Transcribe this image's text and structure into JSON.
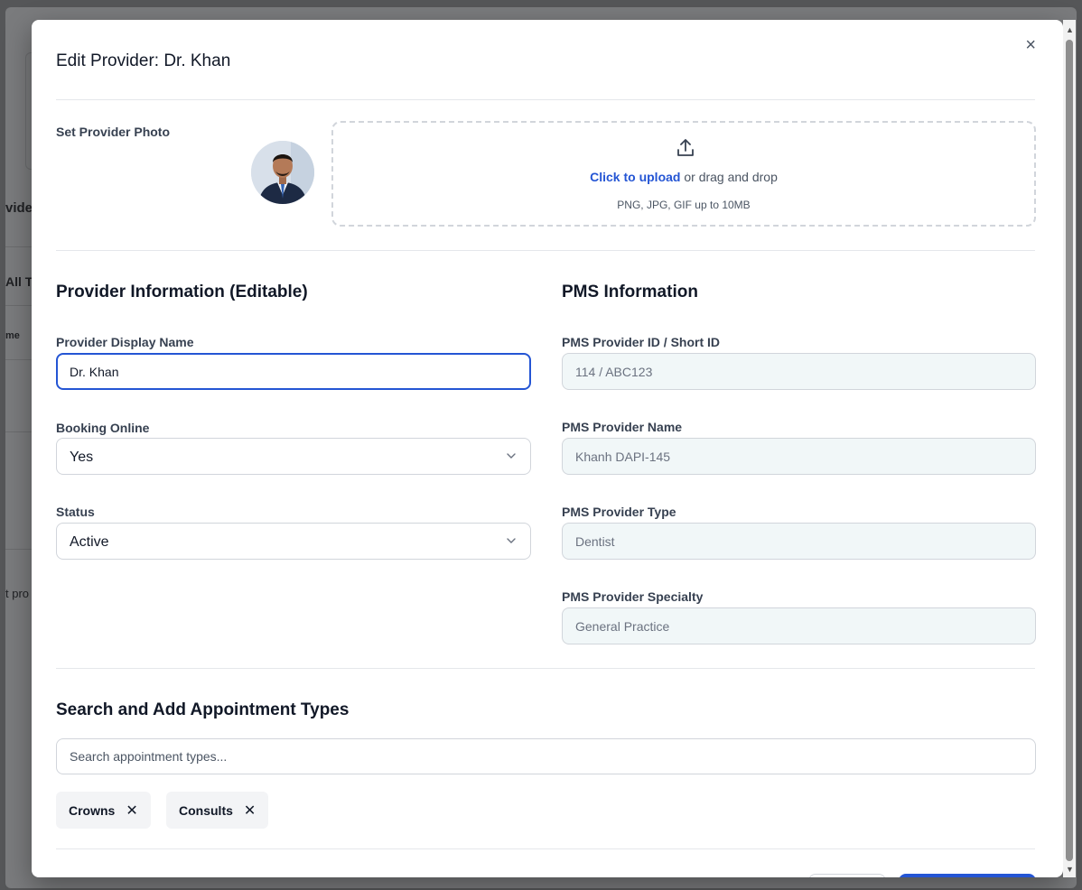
{
  "background": {
    "fragments": [
      "vide",
      "All Ty",
      "me",
      "t pro"
    ]
  },
  "modal": {
    "title": "Edit Provider: Dr. Khan",
    "close_icon": "×",
    "photo": {
      "label": "Set Provider Photo",
      "upload_link": "Click to upload",
      "upload_rest": " or drag and drop",
      "upload_hint": "PNG, JPG, GIF up to 10MB",
      "icon": "upload-icon"
    },
    "provider_info": {
      "title": "Provider Information (Editable)",
      "display_name_label": "Provider Display Name",
      "display_name_value": "Dr. Khan",
      "booking_label": "Booking Online",
      "booking_value": "Yes",
      "status_label": "Status",
      "status_value": "Active"
    },
    "pms_info": {
      "title": "PMS Information",
      "id_label": "PMS Provider ID / Short ID",
      "id_value": "114 / ABC123",
      "name_label": "PMS Provider Name",
      "name_value": "Khanh DAPI-145",
      "type_label": "PMS Provider Type",
      "type_value": "Dentist",
      "specialty_label": "PMS Provider Specialty",
      "specialty_value": "General Practice"
    },
    "appointments": {
      "title": "Search and Add Appointment Types",
      "search_placeholder": "Search appointment types...",
      "chips": [
        "Crowns",
        "Consults"
      ],
      "remove_icon": "✕"
    }
  },
  "colors": {
    "accent": "#2455d4",
    "readonly_bg": "#f1f7f8",
    "overlay": "#555658"
  }
}
